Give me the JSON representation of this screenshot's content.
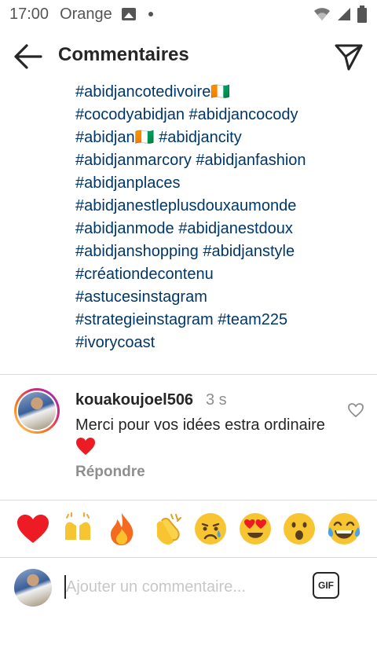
{
  "status_bar": {
    "time": "17:00",
    "carrier": "Orange",
    "icons": [
      "gallery-icon",
      "notification-dot",
      "wifi-icon",
      "signal-icon",
      "battery-icon"
    ]
  },
  "appbar": {
    "title": "Commentaires",
    "back_icon": "arrow-left-icon",
    "send_icon": "paper-plane-icon"
  },
  "caption": {
    "hashtag_color": "#00376b",
    "lines": [
      "#abidjancotedivoire🇨🇮",
      "#cocodyabidjan #abidjancocody",
      "#abidjan🇨🇮 #abidjancity",
      "#abidjanmarcory #abidjanfashion",
      "#abidjanplaces",
      "#abidjanestleplusdouxaumonde",
      "#abidjanmode #abidjanestdoux",
      "#abidjanshopping #abidjanstyle",
      "#créationdecontenu",
      "#astucesinstagram",
      "#strategieinstagram #team225",
      "#ivorycoast"
    ]
  },
  "comment": {
    "username": "kouakoujoel506",
    "time": "3 s",
    "text": "Merci pour vos idées estra ordinaire",
    "reply_label": "Répondre",
    "like_icon": "heart-outline-icon"
  },
  "emoji_bar": {
    "items": [
      {
        "emoji": "❤️",
        "name": "red-heart"
      },
      {
        "emoji": "🙌",
        "name": "raising-hands"
      },
      {
        "emoji": "🔥",
        "name": "fire"
      },
      {
        "emoji": "👏",
        "name": "clapping-hands"
      },
      {
        "emoji": "😢",
        "name": "crying-face"
      },
      {
        "emoji": "😍",
        "name": "heart-eyes"
      },
      {
        "emoji": "😮",
        "name": "surprised-face"
      },
      {
        "emoji": "😂",
        "name": "tears-of-joy"
      }
    ]
  },
  "composer": {
    "placeholder": "Ajouter un commentaire...",
    "gif_label": "GIF"
  },
  "colors": {
    "link": "#00376b",
    "muted": "#8e8e8e",
    "divider": "#dbdbdb",
    "heart_red": "#ed1c24"
  }
}
